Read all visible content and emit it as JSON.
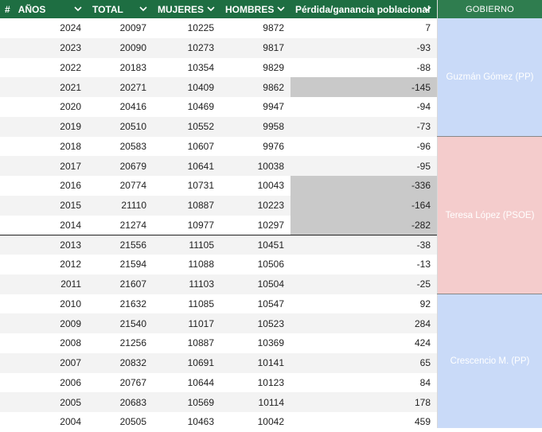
{
  "headers": {
    "hash": "#",
    "years": "AÑOS",
    "total": "TOTAL",
    "women": "MUJERES",
    "men": "HOMBRES",
    "diff": "Pérdida/ganancia poblacional",
    "gov": "GOBIERNO"
  },
  "rows": [
    {
      "year": "2024",
      "total": "20097",
      "women": "10225",
      "men": "9872",
      "diff": "7"
    },
    {
      "year": "2023",
      "total": "20090",
      "women": "10273",
      "men": "9817",
      "diff": "-93"
    },
    {
      "year": "2022",
      "total": "20183",
      "women": "10354",
      "men": "9829",
      "diff": "-88"
    },
    {
      "year": "2021",
      "total": "20271",
      "women": "10409",
      "men": "9862",
      "diff": "-145"
    },
    {
      "year": "2020",
      "total": "20416",
      "women": "10469",
      "men": "9947",
      "diff": "-94"
    },
    {
      "year": "2019",
      "total": "20510",
      "women": "10552",
      "men": "9958",
      "diff": "-73"
    },
    {
      "year": "2018",
      "total": "20583",
      "women": "10607",
      "men": "9976",
      "diff": "-96"
    },
    {
      "year": "2017",
      "total": "20679",
      "women": "10641",
      "men": "10038",
      "diff": "-95"
    },
    {
      "year": "2016",
      "total": "20774",
      "women": "10731",
      "men": "10043",
      "diff": "-336"
    },
    {
      "year": "2015",
      "total": "21110",
      "women": "10887",
      "men": "10223",
      "diff": "-164"
    },
    {
      "year": "2014",
      "total": "21274",
      "women": "10977",
      "men": "10297",
      "diff": "-282"
    },
    {
      "year": "2013",
      "total": "21556",
      "women": "11105",
      "men": "10451",
      "diff": "-38"
    },
    {
      "year": "2012",
      "total": "21594",
      "women": "11088",
      "men": "10506",
      "diff": "-13"
    },
    {
      "year": "2011",
      "total": "21607",
      "women": "11103",
      "men": "10504",
      "diff": "-25"
    },
    {
      "year": "2010",
      "total": "21632",
      "women": "11085",
      "men": "10547",
      "diff": "92"
    },
    {
      "year": "2009",
      "total": "21540",
      "women": "11017",
      "men": "10523",
      "diff": "284"
    },
    {
      "year": "2008",
      "total": "21256",
      "women": "10887",
      "men": "10369",
      "diff": "424"
    },
    {
      "year": "2007",
      "total": "20832",
      "women": "10691",
      "men": "10141",
      "diff": "65"
    },
    {
      "year": "2006",
      "total": "20767",
      "women": "10644",
      "men": "10123",
      "diff": "84"
    },
    {
      "year": "2005",
      "total": "20683",
      "women": "10569",
      "men": "10114",
      "diff": "178"
    },
    {
      "year": "2004",
      "total": "20505",
      "women": "10463",
      "men": "10042",
      "diff": "459"
    }
  ],
  "governments": [
    {
      "label": "Guzmán Gómez (PP)",
      "party": "pp"
    },
    {
      "label": "Teresa López (PSOE)",
      "party": "psoe"
    },
    {
      "label": "Crescencio M. (PP)",
      "party": "pp"
    }
  ],
  "colors": {
    "header_green": "#1e6e42",
    "pp_blue": "#c9daf8",
    "psoe_red": "#f4cccc",
    "highlight_gray": "#c9c9c9"
  },
  "icons": {
    "column_menu": "chevron-down-icon"
  }
}
